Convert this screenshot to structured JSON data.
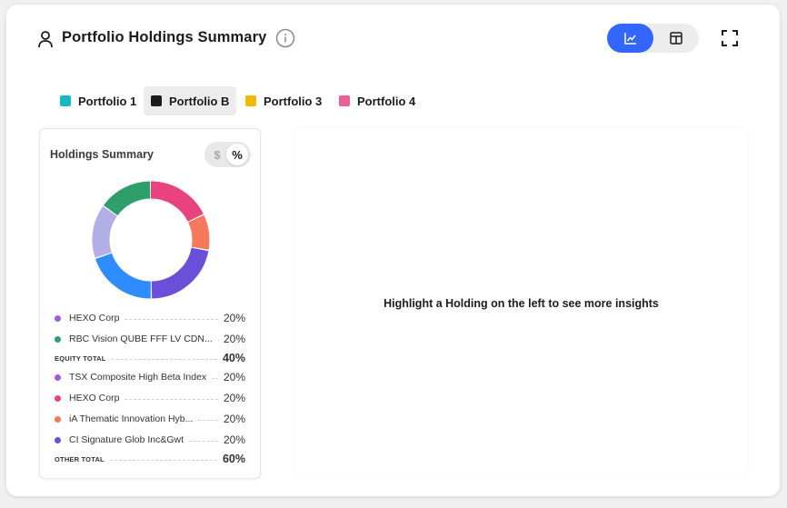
{
  "header": {
    "title": "Portfolio Holdings Summary",
    "icons": [
      "user-icon",
      "info-icon",
      "line-chart-icon",
      "table-icon",
      "expand-icon"
    ]
  },
  "view_toggle": {
    "selected": "chart"
  },
  "colors": {
    "accent": "#3366ff",
    "portfolio_1": "#1ab8c4",
    "portfolio_b": "#1c1c1c",
    "portfolio_3": "#f5b800",
    "portfolio_4": "#e9609a"
  },
  "portfolios": [
    {
      "label": "Portfolio 1",
      "color": "#1ab8c4",
      "selected": false
    },
    {
      "label": "Portfolio B",
      "color": "#1c1c1c",
      "selected": true
    },
    {
      "label": "Portfolio 3",
      "color": "#f5b800",
      "selected": false
    },
    {
      "label": "Portfolio 4",
      "color": "#e9609a",
      "selected": false
    }
  ],
  "summary": {
    "title": "Holdings Summary",
    "unit_dollar": "$",
    "unit_percent": "%",
    "selected_unit": "%",
    "rows": [
      {
        "name": "HEXO Corp",
        "pct": "20%",
        "dot": "#a259e6"
      },
      {
        "name": "RBC Vision QUBE FFF LV CDN...",
        "pct": "20%",
        "dot": "#2e9e6a"
      },
      {
        "name": "EQUITY TOTAL",
        "pct": "40%",
        "total": true
      },
      {
        "name": "TSX Composite High Beta Index",
        "pct": "20%",
        "dot": "#a259e6"
      },
      {
        "name": "HEXO Corp",
        "pct": "20%",
        "dot": "#e8437c"
      },
      {
        "name": "iA Thematic Innovation Hyb...",
        "pct": "20%",
        "dot": "#f07a55"
      },
      {
        "name": "CI Signature Glob Inc&Gwt",
        "pct": "20%",
        "dot": "#6b4fd8"
      },
      {
        "name": "OTHER TOTAL",
        "pct": "60%",
        "total": true
      }
    ],
    "donut_segments": [
      {
        "color": "#e8437c",
        "pct": 18
      },
      {
        "color": "#f5795a",
        "pct": 10
      },
      {
        "color": "#6b4fd8",
        "pct": 22
      },
      {
        "color": "#2f8cff",
        "pct": 20
      },
      {
        "color": "#b3aee6",
        "pct": 15
      },
      {
        "color": "#2e9e6a",
        "pct": 15
      }
    ]
  },
  "insights": {
    "message": "Highlight a Holding on the left to see more insights"
  }
}
